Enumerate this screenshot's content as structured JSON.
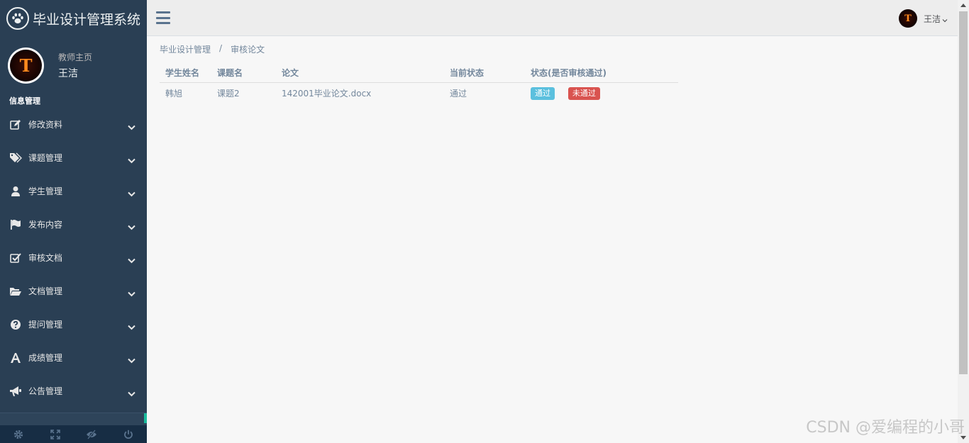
{
  "sidebar": {
    "brand_title": "毕业设计管理系统",
    "welcome": "教师主页",
    "user_name": "王洁",
    "section_title": "信息管理",
    "items": [
      {
        "label": "修改资料",
        "icon": "edit-icon"
      },
      {
        "label": "课题管理",
        "icon": "tags-icon"
      },
      {
        "label": "学生管理",
        "icon": "user-icon"
      },
      {
        "label": "发布内容",
        "icon": "flag-icon"
      },
      {
        "label": "审核文档",
        "icon": "check-square-icon"
      },
      {
        "label": "文档管理",
        "icon": "folder-open-icon"
      },
      {
        "label": "提问管理",
        "icon": "question-circle-icon"
      },
      {
        "label": "成绩管理",
        "icon": "font-icon"
      },
      {
        "label": "公告管理",
        "icon": "bullhorn-icon"
      }
    ],
    "footer_icons": [
      "gear-icon",
      "fullscreen-icon",
      "eye-slash-icon",
      "power-icon"
    ]
  },
  "topnav": {
    "user_name": "王洁"
  },
  "breadcrumb": {
    "items": [
      "毕业设计管理",
      "审核论文"
    ],
    "separator": "/"
  },
  "table": {
    "headers": [
      "学生姓名",
      "课题名",
      "论文",
      "当前状态",
      "状态(是否审核通过)"
    ],
    "rows": [
      {
        "student": "韩旭",
        "topic": "课题2",
        "paper": "142001毕业论文.docx",
        "status": "通过",
        "approve_label": "通过",
        "reject_label": "未通过"
      }
    ]
  },
  "watermark": "CSDN @爱编程的小哥",
  "colors": {
    "sidebar_bg": "#2a3f54",
    "content_bg": "#f7f7f7",
    "badge_pass": "#5bc0de",
    "badge_fail": "#d9534f",
    "accent": "#1abb9c"
  }
}
